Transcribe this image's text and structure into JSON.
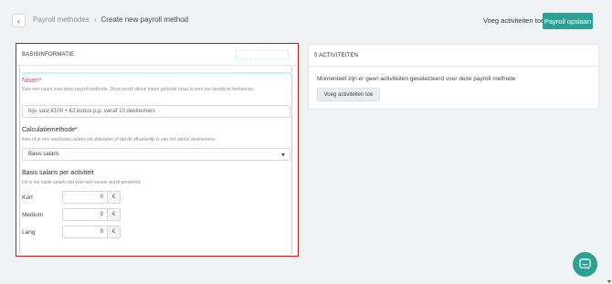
{
  "breadcrumb": {
    "parent": "Payroll methodes",
    "current": "Create new payroll method"
  },
  "header": {
    "add_activities_link": "Voeg activiteiten toe",
    "save_button": "Payroll opslaan"
  },
  "basis": {
    "title": "BASISINFORMATIE",
    "name_label": "Naam*",
    "name_help": "Kies een naam voor deze payroll methode. Deze wordt alleen intern gebruikt maar is voor jou handig te herkennen.",
    "name_placeholder": "bijv. vast €100 + €2 bonus p.p. vanaf 10 deelnemers",
    "calc_label": "Calculatiemethode*",
    "calc_help": "Kies of je een vast basis salaris wil uitbetalen of dat dit afhankelijk is van het aantal deelnemers.",
    "calc_value": "Basis salaris",
    "salary_label": "Basis salaris per activiteit",
    "salary_help": "Dit is het vaste salaris dat voor een sessie wordt gerekend.",
    "rows": [
      {
        "label": "Kort",
        "value": "0",
        "unit": "€"
      },
      {
        "label": "Medium",
        "value": "0",
        "unit": "€"
      },
      {
        "label": "Lang",
        "value": "0",
        "unit": "€"
      }
    ]
  },
  "activities": {
    "title": "0 ACTIVITEITEN",
    "empty_text": "Momenteel zijn er geen activiteiten geselecteerd voor deze payroll methode",
    "add_button": "Voeg activiteiten toe"
  },
  "colors": {
    "accent": "#2aa193",
    "highlight_border": "#b51f1f",
    "required_label": "#e0447e"
  },
  "icons": {
    "back": "chevron-left-icon",
    "separator": "chevron-right-icon",
    "dropdown": "caret-down-icon",
    "chat": "chat-bubble-icon"
  }
}
